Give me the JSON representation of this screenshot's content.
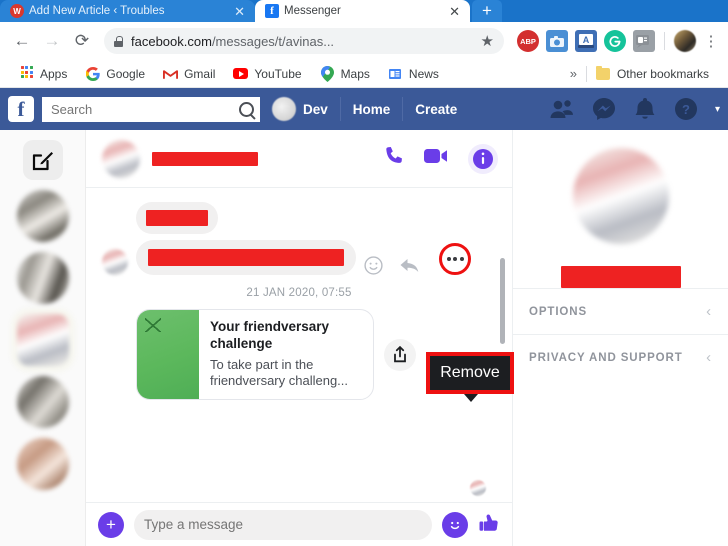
{
  "browser": {
    "tabs": [
      {
        "title": "Add New Article ‹ Troubles",
        "favicon": "wordpress-icon",
        "active": false,
        "close_label": "✕"
      },
      {
        "title": "Messenger",
        "favicon": "facebook-icon",
        "active": true,
        "close_label": "✕"
      }
    ],
    "new_tab_label": "+",
    "nav": {
      "back": "←",
      "forward": "→",
      "reload": "⟳"
    },
    "omnibox": {
      "lock_icon": "lock-icon",
      "url_domain": "facebook.com",
      "url_path": "/messages/t/avinas...",
      "star_icon": "★"
    },
    "extensions": [
      {
        "name": "adblock-plus-extension",
        "label": "ABP"
      },
      {
        "name": "screenshot-camera-extension",
        "label": "▣"
      },
      {
        "name": "blue-a-extension",
        "label": "A"
      },
      {
        "name": "grammarly-extension",
        "label": "G"
      },
      {
        "name": "card-extension",
        "label": "▤"
      }
    ],
    "profile_icon": "profile-avatar",
    "menu_icon": "⋮",
    "bookmarks": [
      {
        "name": "apps",
        "label": "Apps",
        "icon": "apps-grid-icon"
      },
      {
        "name": "google",
        "label": "Google",
        "icon": "google-icon"
      },
      {
        "name": "gmail",
        "label": "Gmail",
        "icon": "gmail-icon"
      },
      {
        "name": "youtube",
        "label": "YouTube",
        "icon": "youtube-icon"
      },
      {
        "name": "maps",
        "label": "Maps",
        "icon": "maps-pin-icon"
      },
      {
        "name": "news",
        "label": "News",
        "icon": "google-news-icon"
      }
    ],
    "bookmarks_overflow": "»",
    "other_bookmarks": "Other bookmarks"
  },
  "facebook_bar": {
    "logo": "f",
    "search_placeholder": "Search",
    "search_value": "",
    "search_icon": "search-icon",
    "user_name": "Dev",
    "links": [
      "Home",
      "Create"
    ],
    "icons": [
      "friend-requests-icon",
      "messenger-icon",
      "notifications-icon",
      "help-icon"
    ],
    "caret": "▾"
  },
  "rail": {
    "compose_icon": "compose-icon",
    "thread_count": 5
  },
  "conversation": {
    "header": {
      "avatar": "contact-avatar",
      "name_redacted": true,
      "actions": [
        "voice-call-icon",
        "video-call-icon",
        "conversation-info-icon"
      ]
    },
    "messages": [
      {
        "type": "redacted-bubble",
        "width": 62,
        "has_avatar": false
      },
      {
        "type": "redacted-bubble",
        "width": 196,
        "has_avatar": true,
        "reaction_icon": "emoji-icon",
        "reply_icon": "reply-icon",
        "more_icon": "more-options-icon"
      }
    ],
    "timestamp": "21 JAN 2020, 07:55",
    "card": {
      "title": "Your friendversary challenge",
      "subtitle": "To take part in the friendversary challeng...",
      "thumb": "friendversary-thumbnail",
      "share_icon": "share-icon"
    },
    "composer": {
      "add_icon": "+",
      "placeholder": "Type a message",
      "value": "",
      "emoji_icon": "emoji-icon",
      "like_icon": "thumbs-up-icon"
    }
  },
  "highlight": {
    "tooltip_label": "Remove",
    "tooltip_border_color": "#ee1111",
    "tooltip_bg_color": "#1c1e21",
    "circle_border_color": "#ee1111",
    "target": "more-options-icon"
  },
  "right_panel": {
    "avatar": "profile-photo",
    "name_redacted": true,
    "sections": [
      {
        "label": "OPTIONS",
        "chevron": "‹"
      },
      {
        "label": "PRIVACY AND SUPPORT",
        "chevron": "‹"
      }
    ]
  },
  "colors": {
    "facebook_blue": "#3b5998",
    "chrome_blue": "#1a73c9",
    "messenger_purple": "#6a3de8",
    "redaction_red": "#ee2222",
    "highlight_red": "#ee1111",
    "card_green": "#5cb85c"
  }
}
